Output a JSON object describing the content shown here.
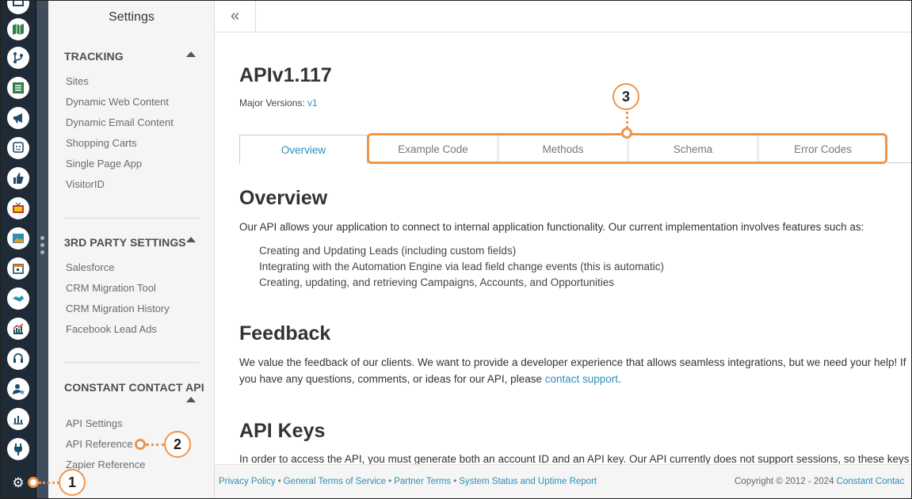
{
  "rail": {
    "icons": [
      "desktop-icon",
      "map-icon",
      "branch-icon",
      "list-icon",
      "megaphone-icon",
      "chat-face-icon",
      "thumbs-up-icon",
      "tv-icon",
      "image-icon",
      "calendar-icon",
      "handshake-icon",
      "trend-chart-icon",
      "headset-icon",
      "user-star-icon",
      "bar-chart-icon",
      "plug-icon"
    ],
    "gear": "gear-icon"
  },
  "sidebar": {
    "title": "Settings",
    "tracking": {
      "heading": "TRACKING",
      "items": [
        "Sites",
        "Dynamic Web Content",
        "Dynamic Email Content",
        "Shopping Carts",
        "Single Page App",
        "VisitorID"
      ]
    },
    "third_party": {
      "heading": "3RD PARTY SETTINGS",
      "items": [
        "Salesforce",
        "CRM Migration Tool",
        "CRM Migration History",
        "Facebook Lead Ads"
      ]
    },
    "cc_api": {
      "heading": "CONSTANT CONTACT API",
      "items": [
        "API Settings",
        "API Reference",
        "Zapier Reference"
      ]
    }
  },
  "topbar": {
    "collapse": "«"
  },
  "main": {
    "title": "APIv1.117",
    "major_label": "Major Versions:",
    "major_value": "v1",
    "tabs": [
      "Overview",
      "Example Code",
      "Methods",
      "Schema",
      "Error Codes"
    ],
    "overview": {
      "heading": "Overview",
      "intro": "Our API allows your application to connect to internal application functionality. Our current implementation involves features such as:",
      "bullets": [
        "Creating and Updating Leads (including custom fields)",
        "Integrating with the Automation Engine via lead field change events (this is automatic)",
        "Creating, updating, and retrieving Campaigns, Accounts, and Opportunities"
      ]
    },
    "feedback": {
      "heading": "Feedback",
      "line1": "We value the feedback of our clients. We want to provide a developer experience that allows seamless integrations, but we need your help! If",
      "line2_pre": "you have any questions, comments, or ideas for our API, please ",
      "line2_link": "contact support",
      "line2_post": "."
    },
    "api_keys": {
      "heading": "API Keys",
      "line1": "In order to access the API, you must generate both an account ID and an API key. Our API currently does not support sessions, so these keys"
    }
  },
  "footer": {
    "links": [
      "Privacy Policy",
      "General Terms of Service",
      "Partner Terms",
      "System Status and Uptime Report"
    ],
    "separator": "•",
    "copyright_pre": "Copyright © 2012 - 2024 ",
    "copyright_link": "Constant Contac"
  },
  "callouts": [
    "1",
    "2",
    "3"
  ],
  "colors": {
    "accent_link": "#2b8fb8",
    "callout": "#f0954a",
    "rail_bg": "#1e2a36"
  }
}
